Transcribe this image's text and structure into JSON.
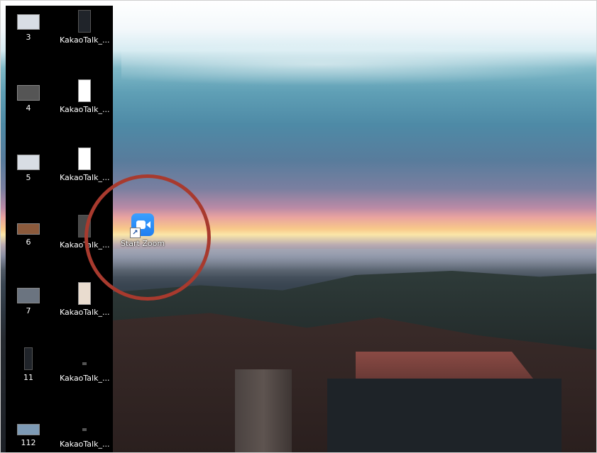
{
  "desktop": {
    "left_column": [
      {
        "label": "3",
        "thumb": "screenshot-icon"
      },
      {
        "label": "4",
        "thumb": "screenshot-icon"
      },
      {
        "label": "5",
        "thumb": "screenshot-icon"
      },
      {
        "label": "6",
        "thumb": "photo-icon"
      },
      {
        "label": "7",
        "thumb": "photo-icon"
      },
      {
        "label": "11",
        "thumb": "photo-icon"
      },
      {
        "label": "112",
        "thumb": "photo-icon"
      }
    ],
    "right_column": [
      {
        "label": "KakaoTalk_...",
        "thumb": "image-file-icon"
      },
      {
        "label": "KakaoTalk_...",
        "thumb": "image-file-icon"
      },
      {
        "label": "KakaoTalk_...",
        "thumb": "image-file-icon"
      },
      {
        "label": "KakaoTalk_...",
        "thumb": "image-file-icon"
      },
      {
        "label": "KakaoTalk_...",
        "thumb": "image-file-icon"
      },
      {
        "label": "KakaoTalk_...",
        "thumb": "image-file-icon"
      },
      {
        "label": "KakaoTalk_...",
        "thumb": "image-file-icon"
      }
    ],
    "shortcut": {
      "label": "Start Zoom",
      "icon": "zoom-camera-icon",
      "overlay_icon": "shortcut-arrow-icon",
      "arrow_glyph": "↗"
    },
    "colors": {
      "highlight_ring": "#a83a2e",
      "zoom_blue": "#2d8cff"
    }
  }
}
